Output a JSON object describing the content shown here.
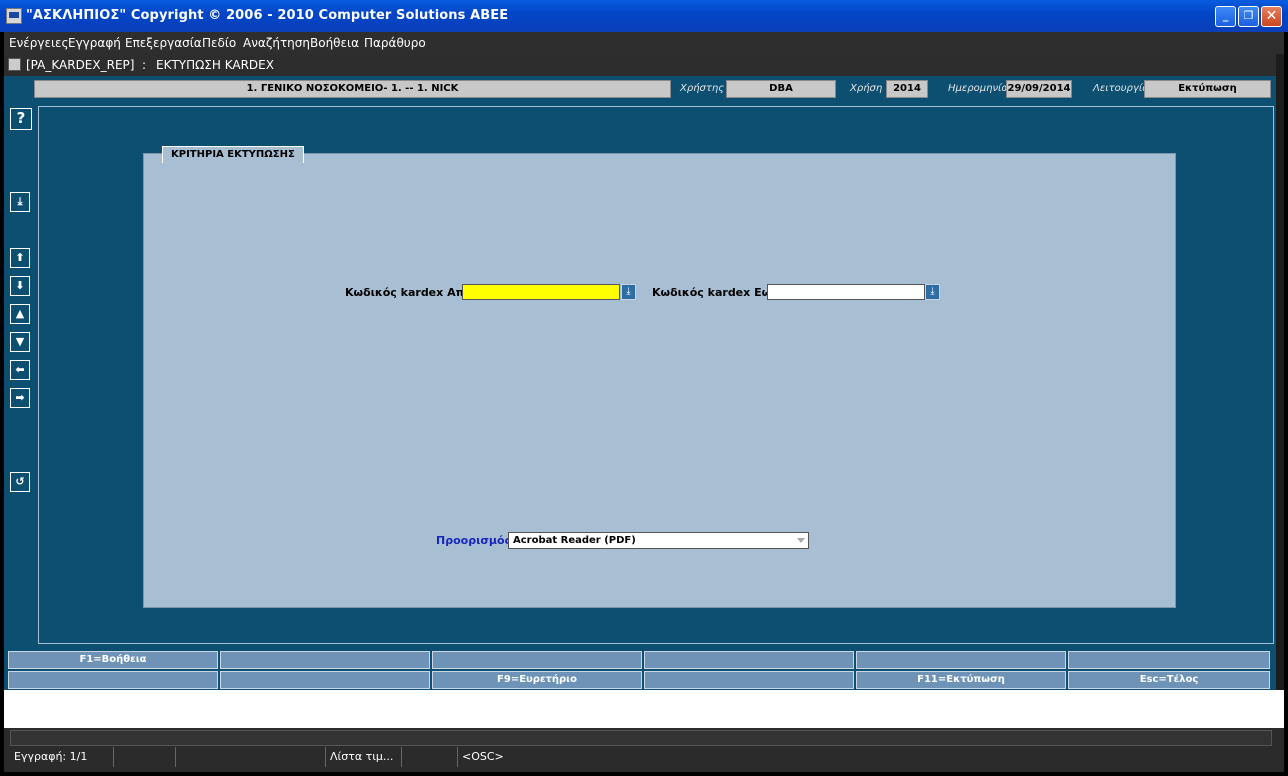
{
  "window": {
    "title": "\"ΑΣΚΛΗΠΙΟΣ\" Copyright © 2006 - 2010 Computer Solutions ΑΒΕΕ",
    "minimize_icon": "minimize-icon",
    "restore_icon": "restore-icon",
    "close_icon": "close-icon"
  },
  "menu": {
    "items": [
      "Ενέργειες",
      "Εγγραφή",
      "Επεξεργασία",
      "Πεδίο",
      "Αναζήτηση",
      "Βοήθεια",
      "Παράθυρο"
    ]
  },
  "form": {
    "code": "[PA_KARDEX_REP]",
    "separator": ":",
    "title": "ΕΚΤΥΠΩΣΗ KARDEX"
  },
  "info": {
    "organization": "1. ΓΕΝΙΚΟ ΝΟΣΟΚΟΜΕΙΟ- 1. -- 1. NICK",
    "user_label": "Χρήστης",
    "user": "DBA",
    "year_label": "Χρήση",
    "year": "2014",
    "date_label": "Ημερομηνία",
    "date": "29/09/2014",
    "function_label": "Λειτουργία",
    "function": "Εκτύπωση"
  },
  "toolbar": {
    "help": "?",
    "icons": [
      "help-icon",
      "lov-icon",
      "first-record-icon",
      "next-record-icon",
      "previous-page-icon",
      "next-page-icon",
      "previous-field-icon",
      "next-field-icon",
      "exit-icon"
    ]
  },
  "criteria": {
    "section_title": "ΚΡΙΤΗΡΙΑ ΕΚΤΥΠΩΣΗΣ",
    "from_label": "Κωδικός kardex Από",
    "from_value": "",
    "to_label": "Κωδικός kardex Εως",
    "to_value": "",
    "destination_label": "Προορισμός",
    "destination_value": "Acrobat Reader (PDF)"
  },
  "function_keys": {
    "row1": [
      "F1=Βοήθεια",
      "",
      "",
      "",
      "",
      ""
    ],
    "row2": [
      "",
      "",
      "F9=Ευρετήριο",
      "",
      "F11=Εκτύπωση",
      "Esc=Τέλος"
    ]
  },
  "status": {
    "record": "Εγγραφή: 1/1",
    "list": "Λίστα τιμ...",
    "mode": "<OSC>"
  },
  "colors": {
    "titlebar": "#0146c7",
    "form_background": "#0c4f71",
    "panel": "#a8bfd3",
    "required_field": "#ffff00",
    "function_key": "#6e93b6",
    "destination_label": "#1726b8"
  }
}
